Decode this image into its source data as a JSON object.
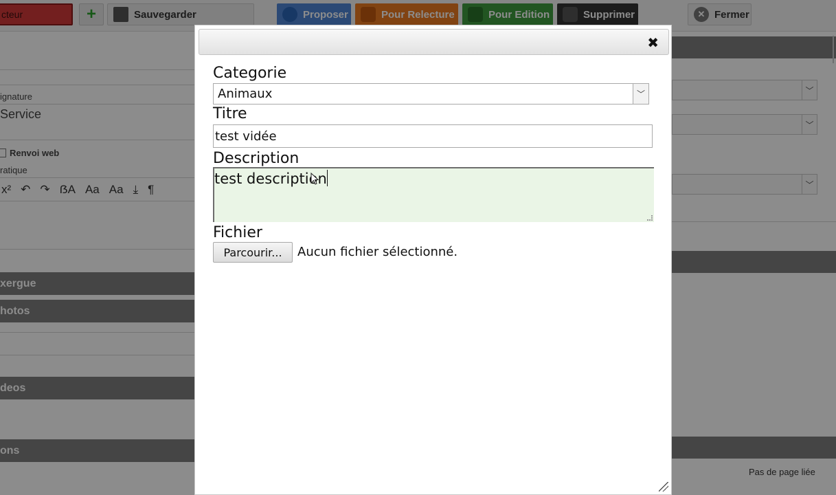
{
  "toolbar": {
    "field_fragment": "cteur",
    "add_icon": "plus-icon",
    "save_label": "Sauvegarder",
    "proposer_label": "Proposer",
    "relecture_label": "Pour Relecture",
    "edition_label": "Pour Edition",
    "supprimer_label": "Supprimer",
    "fermer_label": "Fermer",
    "colors": {
      "proposer": "#4f86d6",
      "relecture": "#ec7a22",
      "edition": "#3f9b3f",
      "supprimer": "#333333",
      "field": "#d23a3a"
    }
  },
  "background": {
    "signature_label": "ignature",
    "service_value": "Service",
    "renvoi_web_label": "Renvoi web",
    "pratique_label": "ratique",
    "sections": [
      "xergue",
      "hotos",
      "deos",
      "ons"
    ],
    "linked_page_text": "Pas de page liée",
    "editor_tools": [
      "x²",
      "↶",
      "↷",
      "ẞA",
      "Aa",
      "Aa",
      "⤓",
      "¶"
    ]
  },
  "dialog": {
    "close_icon": "close-icon",
    "categorie_label": "Categorie",
    "categorie_value": "Animaux",
    "titre_label": "Titre",
    "titre_value": "test vidée",
    "description_label": "Description",
    "description_value": "test description",
    "fichier_label": "Fichier",
    "browse_button": "Parcourir...",
    "file_status": "Aucun fichier sélectionné."
  }
}
